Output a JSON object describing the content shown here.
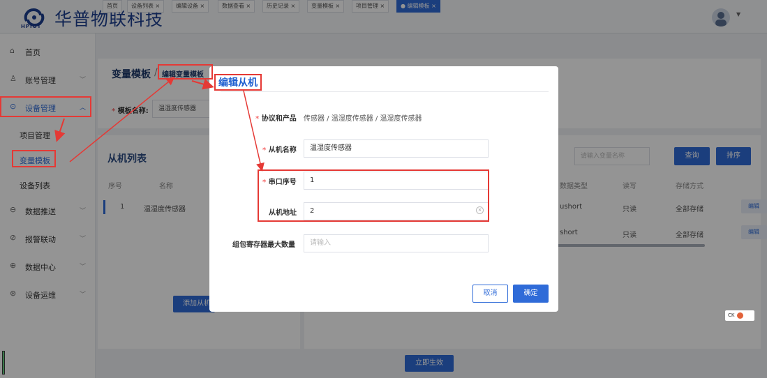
{
  "brand": {
    "name": "华普物联科技",
    "logo_sub": "HPIOT"
  },
  "tabs": [
    "首页",
    "设备列表 ×",
    "编辑设备 ×",
    "数据查看 ×",
    "历史记录 ×",
    "变量模板 ×",
    "项目管理 ×",
    "● 编辑模板 ×"
  ],
  "sidebar": {
    "items": [
      {
        "label": "首页",
        "icon": "home-icon"
      },
      {
        "label": "账号管理",
        "icon": "user-icon"
      },
      {
        "label": "设备管理",
        "icon": "device-icon"
      },
      {
        "label": "数据推送",
        "icon": "push-icon"
      },
      {
        "label": "报警联动",
        "icon": "alarm-icon"
      },
      {
        "label": "数据中心",
        "icon": "data-icon"
      },
      {
        "label": "设备运维",
        "icon": "maintenance-icon"
      }
    ],
    "sub_items": [
      "项目管理",
      "变量模板",
      "设备列表"
    ]
  },
  "breadcrumb": {
    "title": "变量模板",
    "sep": "/",
    "sub": "编辑变量模板"
  },
  "template": {
    "label": "模板名称:",
    "value": "温湿度传感器"
  },
  "slave_list": {
    "title": "从机列表",
    "headers": [
      "序号",
      "名称"
    ],
    "rows": [
      {
        "index": "1",
        "name": "温湿度传感器"
      }
    ],
    "add_label": "添加从机"
  },
  "variables": {
    "search_placeholder": "请输入变量名称",
    "query_label": "查询",
    "sort_label": "排序",
    "headers": [
      "数据类型",
      "读写",
      "存储方式"
    ],
    "rows": [
      {
        "type": "ushort",
        "rw": "只读",
        "storage": "全部存储",
        "action": "编辑"
      },
      {
        "type": "short",
        "rw": "只读",
        "storage": "全部存储",
        "action": "编辑"
      }
    ]
  },
  "apply_label": "立即生效",
  "dialog": {
    "title": "编辑从机",
    "protocol_label": "协议和产品",
    "protocol_value": "传感器 / 温湿度传感器 / 温湿度传感器",
    "slave_name_label": "从机名称",
    "slave_name_value": "温湿度传感器",
    "serial_label": "串口序号",
    "serial_value": "1",
    "addr_label": "从机地址",
    "addr_value": "2",
    "max_label": "组包寄存器最大数量",
    "max_placeholder": "请输入",
    "cancel_label": "取消",
    "ok_label": "确定"
  },
  "badge_text": "CK",
  "colors": {
    "primary": "#2f6bd8",
    "annotation": "#e53935",
    "brand": "#1d3f8f"
  }
}
